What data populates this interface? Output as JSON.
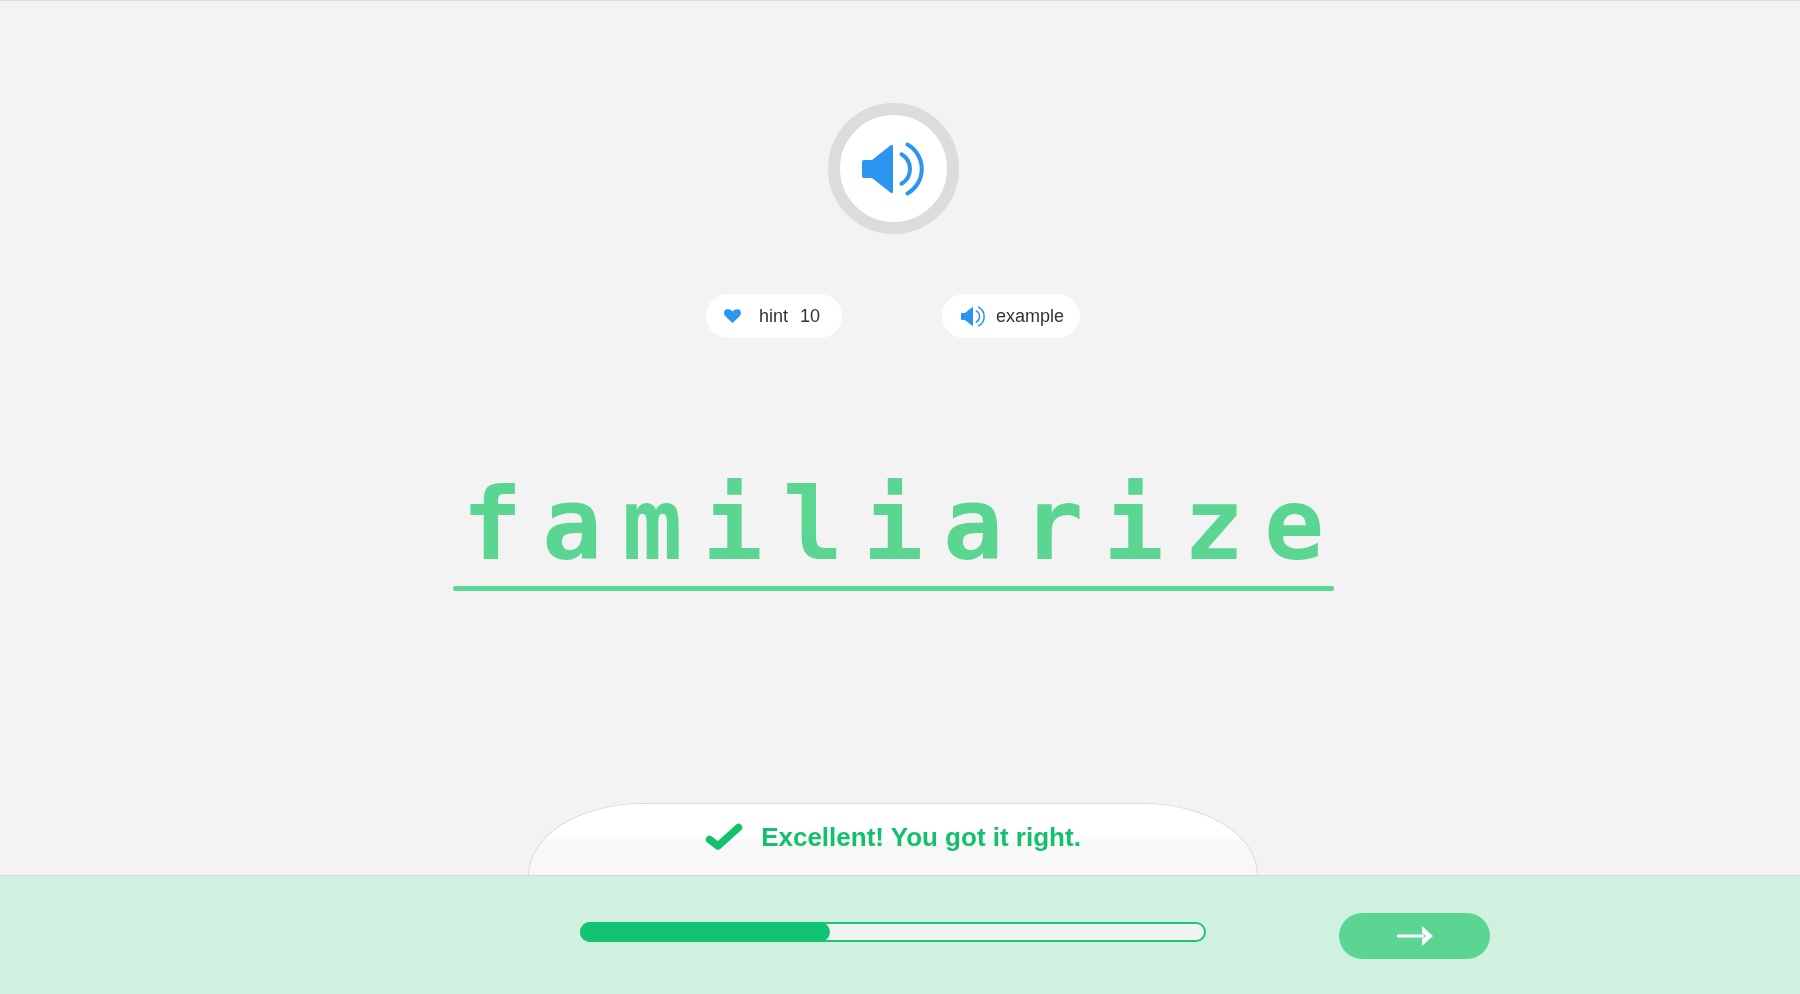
{
  "hint": {
    "label": "hint",
    "count": "10"
  },
  "example": {
    "label": "example"
  },
  "answer": {
    "value": "familiarize"
  },
  "feedback": {
    "correct": true,
    "message": "Excellent! You got it right."
  },
  "progress": {
    "level": 0.4
  }
}
